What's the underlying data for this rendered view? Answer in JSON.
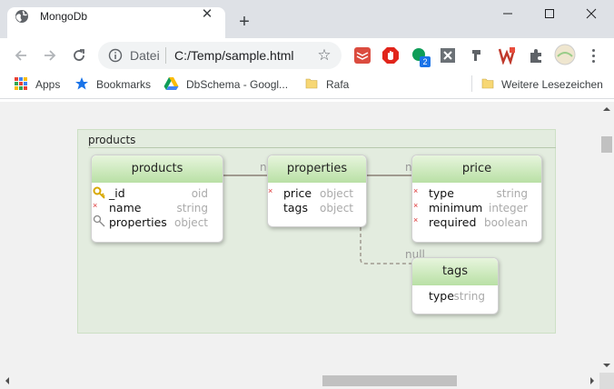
{
  "tab": {
    "title": "MongoDb",
    "close": "✕"
  },
  "new_tab": "+",
  "window": {
    "minimize": "minimize",
    "maximize": "maximize",
    "close": "close"
  },
  "omnibox": {
    "scheme_label": "Datei",
    "url": "C:/Temp/sample.html"
  },
  "bookmarks": {
    "items": [
      {
        "label": "Apps",
        "icon": "apps-grid-icon"
      },
      {
        "label": "Bookmarks",
        "icon": "star-icon"
      },
      {
        "label": "DbSchema - Googl...",
        "icon": "google-drive-icon"
      },
      {
        "label": "Rafa",
        "icon": "folder-icon"
      }
    ],
    "other": {
      "label": "Weitere Lesezeichen",
      "icon": "folder-icon"
    }
  },
  "extensions": {
    "badge_count": "2"
  },
  "diagram": {
    "group_label": "products",
    "entities": {
      "products": {
        "title": "products",
        "fields": [
          {
            "name": "_id",
            "type": "oid",
            "marker": "primary-key"
          },
          {
            "name": "name",
            "type": "string",
            "marker": "required"
          },
          {
            "name": "properties",
            "type": "object",
            "marker": "reference"
          }
        ]
      },
      "properties": {
        "title": "properties",
        "fields": [
          {
            "name": "price",
            "type": "object",
            "marker": "required"
          },
          {
            "name": "tags",
            "type": "object",
            "marker": "none"
          }
        ]
      },
      "price": {
        "title": "price",
        "fields": [
          {
            "name": "type",
            "type": "string",
            "marker": "required"
          },
          {
            "name": "minimum",
            "type": "integer",
            "marker": "required"
          },
          {
            "name": "required",
            "type": "boolean",
            "marker": "required"
          }
        ]
      },
      "tags": {
        "title": "tags",
        "fields": [
          {
            "name": "type",
            "type": "string",
            "marker": "none"
          }
        ]
      }
    },
    "relation_labels": {
      "products_properties": "n",
      "properties_price": "n",
      "properties_tags": "null"
    }
  },
  "colors": {
    "header_green": "#b9e0a5",
    "group_fill": "#e3ecdf",
    "required_marker": "#dd3333",
    "key_icon": "#d8a800"
  }
}
